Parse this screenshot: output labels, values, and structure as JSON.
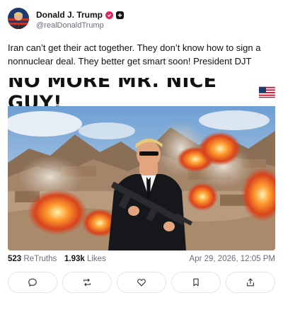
{
  "author": {
    "display_name": "Donald J. Trump",
    "handle": "@realDonaldTrump"
  },
  "post": {
    "text": "Iran can’t get their act together. They don’t know how to sign a nonnuclear deal. They better get smart soon! President DJT",
    "media_headline": "NO MORE MR. NICE GUY!"
  },
  "stats": {
    "retruths_count": "523",
    "retruths_label": "ReTruths",
    "likes_count": "1.93k",
    "likes_label": "Likes",
    "timestamp": "Apr 29, 2026, 12:05 PM"
  },
  "actions": [
    {
      "icon": "reply-icon"
    },
    {
      "icon": "retruth-icon"
    },
    {
      "icon": "like-icon"
    },
    {
      "icon": "bookmark-icon"
    },
    {
      "icon": "share-icon"
    }
  ],
  "colors": {
    "verified": "#e0245e",
    "muted_text": "#6b6b7b",
    "border": "#e4e4ea"
  }
}
